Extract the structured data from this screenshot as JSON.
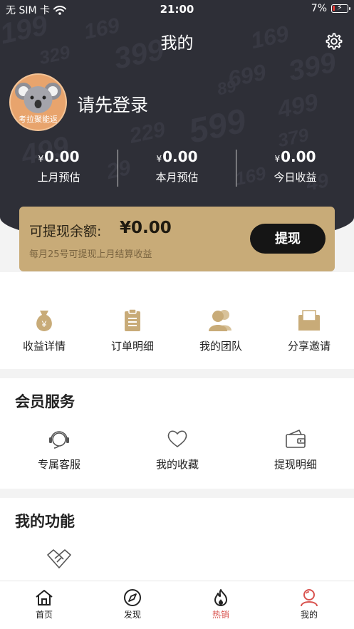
{
  "status_bar": {
    "carrier": "无 SIM 卡",
    "time": "21:00",
    "battery": "7%"
  },
  "header": {
    "title": "我的"
  },
  "background_numbers": [
    "169",
    "399",
    "199",
    "169",
    "399",
    "699",
    "329",
    "89",
    "499",
    "599",
    "229",
    "379",
    "499",
    "29",
    "169",
    "49"
  ],
  "profile": {
    "avatar_text": "考拉聚能返",
    "login_prompt": "请先登录"
  },
  "stats": [
    {
      "currency": "¥",
      "amount": "0.00",
      "label": "上月预估"
    },
    {
      "currency": "¥",
      "amount": "0.00",
      "label": "本月预估"
    },
    {
      "currency": "¥",
      "amount": "0.00",
      "label": "今日收益"
    }
  ],
  "balance_card": {
    "label": "可提现余额:",
    "amount": "¥0.00",
    "note": "每月25号可提现上月结算收益",
    "button": "提现"
  },
  "quick_actions": [
    {
      "label": "收益详情",
      "icon": "money-bag-icon"
    },
    {
      "label": "订单明细",
      "icon": "clipboard-icon"
    },
    {
      "label": "我的团队",
      "icon": "team-icon"
    },
    {
      "label": "分享邀请",
      "icon": "envelope-icon"
    }
  ],
  "member_services": {
    "title": "会员服务",
    "items": [
      {
        "label": "专属客服",
        "icon": "headset-icon"
      },
      {
        "label": "我的收藏",
        "icon": "heart-icon"
      },
      {
        "label": "提现明细",
        "icon": "wallet-icon"
      }
    ]
  },
  "my_functions": {
    "title": "我的功能",
    "items": [
      {
        "icon": "handshake-icon"
      }
    ]
  },
  "tab_bar": {
    "active_color": "#d9534f",
    "items": [
      {
        "label": "首页",
        "icon": "home-icon",
        "active": false
      },
      {
        "label": "发现",
        "icon": "compass-icon",
        "active": false
      },
      {
        "label": "热销",
        "icon": "flame-icon",
        "active": true
      },
      {
        "label": "我的",
        "icon": "user-icon",
        "active": false
      }
    ]
  },
  "colors": {
    "header_bg": "#2e2f37",
    "gold": "#c8ab78",
    "accent_red": "#d9534f"
  }
}
